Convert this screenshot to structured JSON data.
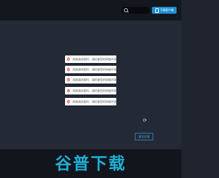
{
  "header": {
    "download_label": "下载客户端"
  },
  "toasts": [
    {
      "message": "网络请求超时，请检查您的网络环境"
    },
    {
      "message": "网络请求超时，请检查您的网络环境"
    },
    {
      "message": "网络请求超时，请检查您的网络环境"
    },
    {
      "message": "网络请求超时，请检查您的网络环境"
    },
    {
      "message": "网络请求超时，请检查您的网络环境"
    }
  ],
  "feedback": {
    "label": "意见反馈"
  },
  "footer": {
    "logo": "谷普下载"
  },
  "colors": {
    "accent": "#1d8fd6",
    "error": "#f25a5a",
    "logo": "#1fb0d8"
  }
}
